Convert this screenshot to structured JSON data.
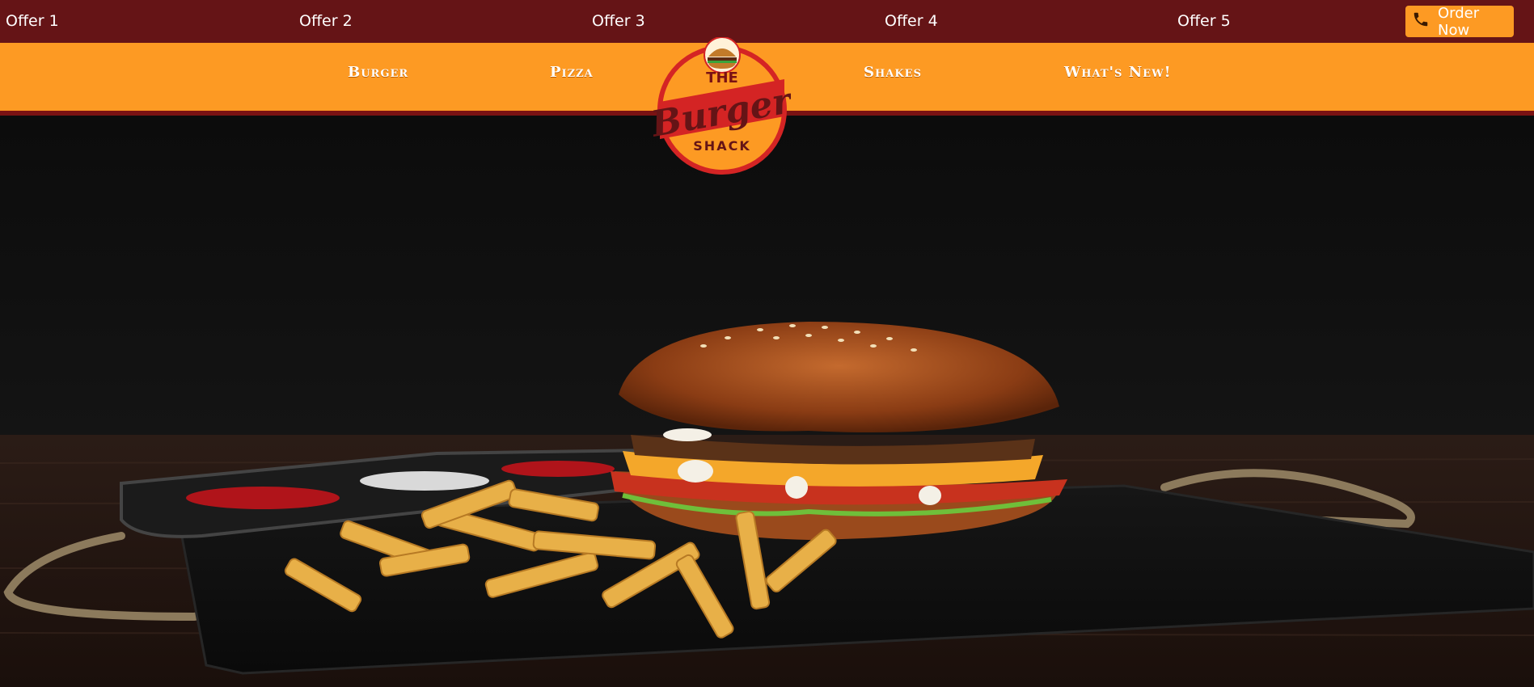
{
  "offers": [
    "Offer 1",
    "Offer 2",
    "Offer 3",
    "Offer 4",
    "Offer 5"
  ],
  "order_button": {
    "label": "Order Now",
    "icon": "phone-icon"
  },
  "nav": {
    "left": [
      "Burger",
      "Pizza"
    ],
    "right": [
      "Shakes",
      "What's New!"
    ]
  },
  "logo": {
    "top": "THE",
    "middle": "Burger",
    "bottom": "SHACK"
  },
  "colors": {
    "offer_bar": "#651416",
    "nav_bar": "#fd9a23",
    "accent_red": "#d42424"
  }
}
